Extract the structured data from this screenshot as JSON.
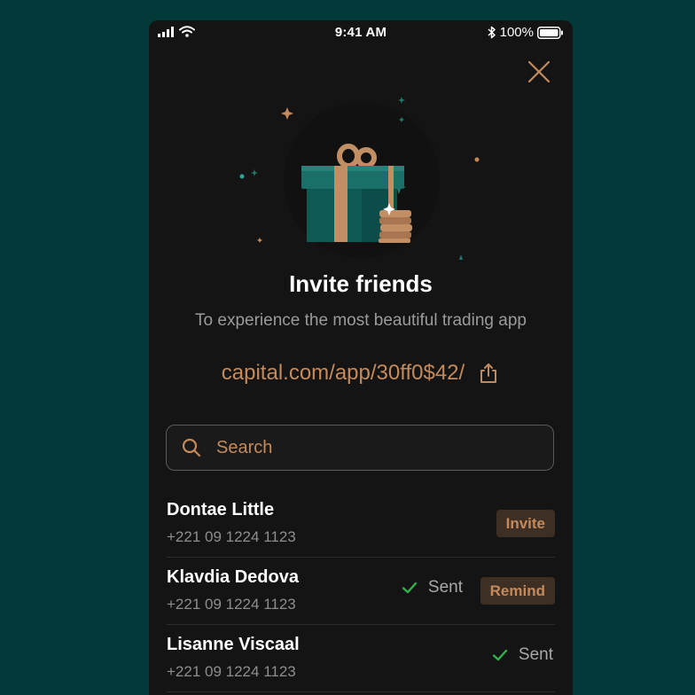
{
  "status_bar": {
    "time": "9:41 AM",
    "battery": "100%"
  },
  "header": {
    "close_icon": "close-icon"
  },
  "invite": {
    "title": "Invite friends",
    "subtitle": "To experience the most beautiful trading app",
    "link": "capital.com/app/30ff0$42/",
    "share_icon": "share-icon"
  },
  "search": {
    "placeholder": "Search"
  },
  "contacts": [
    {
      "name": "Dontae Little",
      "phone": "+221 09 1224 1123",
      "status": "",
      "action": "Invite"
    },
    {
      "name": "Klavdia Dedova",
      "phone": "+221 09 1224 1123",
      "status": "Sent",
      "action": "Remind"
    },
    {
      "name": "Lisanne Viscaal",
      "phone": "+221 09 1224 1123",
      "status": "Sent",
      "action": ""
    }
  ],
  "colors": {
    "background": "#013a38",
    "panel": "#141414",
    "accent": "#c58a5b",
    "pill_bg": "#3e2f25",
    "check": "#2fb34a",
    "muted": "#8e8e8e"
  }
}
